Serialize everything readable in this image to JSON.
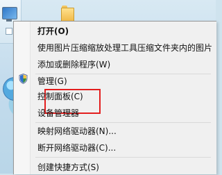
{
  "menu": {
    "items": [
      {
        "label": "打开(O)",
        "bold": true
      },
      {
        "label": "使用图片压缩缩放处理工具压缩文件夹内的图片",
        "bold": false
      },
      {
        "label": "添加或删除程序(W)",
        "bold": false
      },
      {
        "label": "管理(G)",
        "bold": false
      },
      {
        "label": "控制面板(C)",
        "bold": false
      },
      {
        "label": "设备管理器",
        "bold": false
      },
      {
        "label": "映射网络驱动器(N)...",
        "bold": false
      },
      {
        "label": "断开网络驱动器(C)...",
        "bold": false
      },
      {
        "label": "创建快捷方式(S)",
        "bold": false
      }
    ]
  },
  "icons": {
    "computer": "computer-icon",
    "folder": "folder-icon",
    "globe": "globe-icon",
    "shield": "shield-icon"
  },
  "colors": {
    "menu_bg": "#f0f0f0",
    "highlight_border": "#e31d1d"
  }
}
